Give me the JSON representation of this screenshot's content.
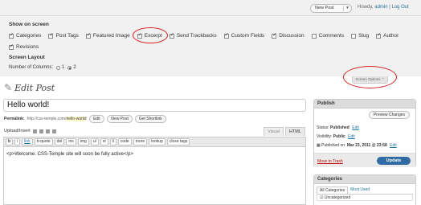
{
  "admin_bar": {
    "new_post": "New Post",
    "howdy_prefix": "Howdy,",
    "user": "admin",
    "separator": "|",
    "logout": "Log Out"
  },
  "screen_options": {
    "show_on_screen": "Show on screen",
    "checkboxes": [
      {
        "label": "Categories",
        "checked": true
      },
      {
        "label": "Post Tags",
        "checked": true
      },
      {
        "label": "Featured Image",
        "checked": true
      },
      {
        "label": "Excerpt",
        "checked": true
      },
      {
        "label": "Send Trackbacks",
        "checked": true
      },
      {
        "label": "Custom Fields",
        "checked": true
      },
      {
        "label": "Discussion",
        "checked": true
      },
      {
        "label": "Comments",
        "checked": false
      },
      {
        "label": "Slug",
        "checked": false
      },
      {
        "label": "Author",
        "checked": true
      },
      {
        "label": "Revisions",
        "checked": true
      }
    ],
    "layout_heading": "Screen Layout",
    "columns_label": "Number of Columns:",
    "col1": "1",
    "col2": "2",
    "selected_columns": 2,
    "tab_label": "Screen Options ⌃"
  },
  "page": {
    "title": "Edit Post"
  },
  "post": {
    "title": "Hello world!",
    "permalink_label": "Permalink:",
    "permalink_base": "http://css-temple.com/",
    "permalink_slug": "hello-world",
    "permalink_end": "/",
    "edit_btn": "Edit",
    "view_btn": "View Post",
    "shortlink_btn": "Get Shortlink",
    "upload_label": "Upload/Insert",
    "tab_visual": "Visual",
    "tab_html": "HTML",
    "quicktags": [
      "b",
      "i",
      "link",
      "b-quote",
      "del",
      "ins",
      "img",
      "ul",
      "ol",
      "li",
      "code",
      "more",
      "lookup",
      "close tags"
    ],
    "content": "<p>Welcome. CSS-Temple site will soon be fully active</p>"
  },
  "publish": {
    "heading": "Publish",
    "preview_btn": "Preview Changes",
    "status_label": "Status:",
    "status_value": "Published",
    "visibility_label": "Visibility:",
    "visibility_value": "Public",
    "published_label": "Published on:",
    "published_value": "Mar 23, 2011 @ 23:58",
    "edit": "Edit",
    "trash": "Move to Trash",
    "update_btn": "Update"
  },
  "categories": {
    "heading": "Categories",
    "tab_all": "All Categories",
    "tab_used": "Most Used",
    "first_item": "Uncategorized"
  },
  "colors": {
    "highlight_circle": "#d42020",
    "link": "#21759b",
    "update_button": "#2f6aa3"
  }
}
